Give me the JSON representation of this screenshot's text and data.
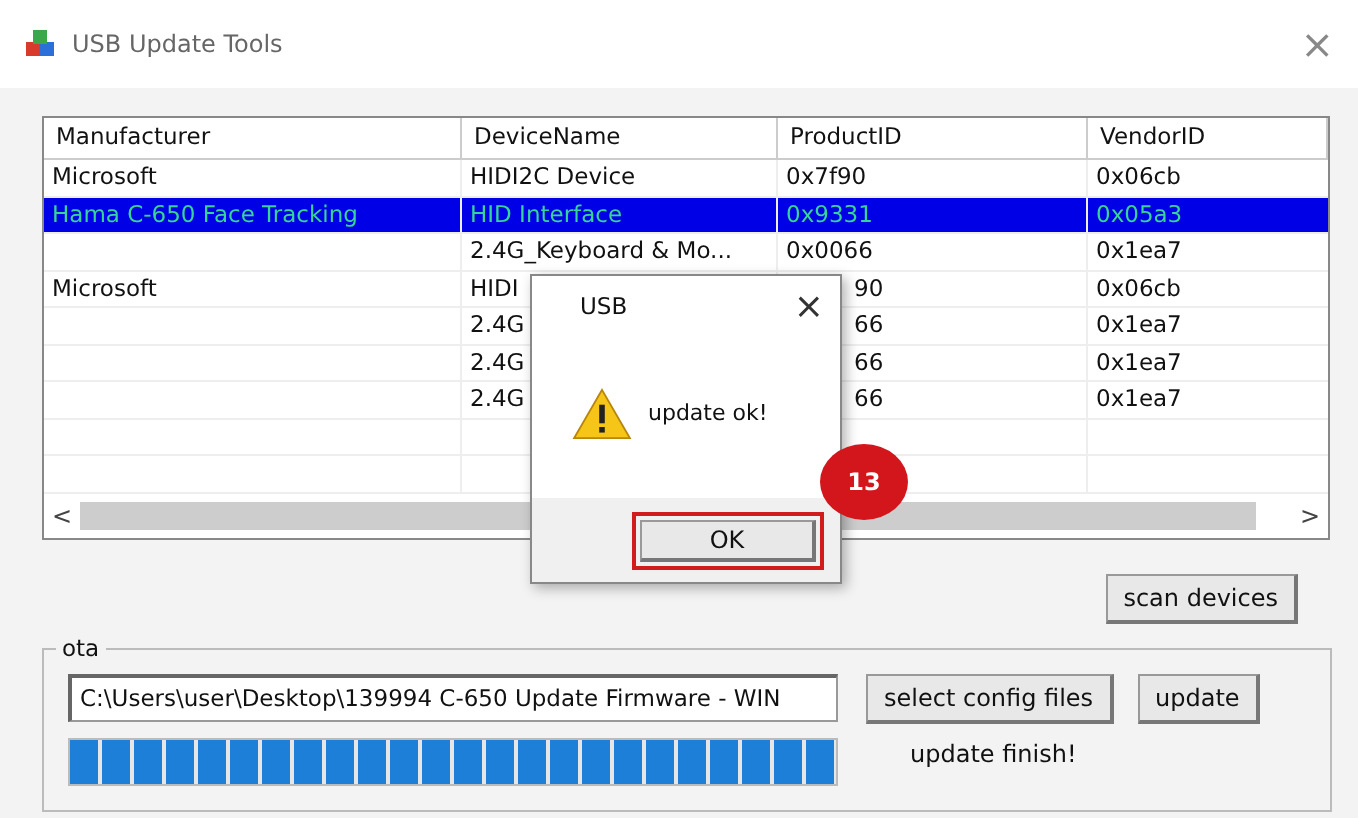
{
  "window": {
    "title": "USB Update Tools",
    "close": "×"
  },
  "table": {
    "columns": [
      "Manufacturer",
      "DeviceName",
      "ProductID",
      "VendorID"
    ],
    "rows": [
      {
        "manufacturer": "Microsoft",
        "device_name": "HIDI2C Device",
        "product_id": "0x7f90",
        "vendor_id": "0x06cb",
        "selected": false,
        "under_dialog": false
      },
      {
        "manufacturer": "Hama C-650 Face Tracking",
        "device_name": "HID Interface",
        "product_id": "0x9331",
        "vendor_id": "0x05a3",
        "selected": true,
        "under_dialog": false
      },
      {
        "device_name": "2.4G_Keyboard & Mo...",
        "product_id": "0x0066",
        "vendor_id": "0x1ea7",
        "selected": false,
        "under_dialog": false
      },
      {
        "manufacturer": "Microsoft",
        "device_name": "HIDI",
        "product_id": "90",
        "vendor_id": "0x06cb",
        "selected": false,
        "under_dialog": true
      },
      {
        "device_name": "2.4G",
        "product_id": "66",
        "vendor_id": "0x1ea7",
        "selected": false,
        "under_dialog": true
      },
      {
        "device_name": "2.4G",
        "product_id": "66",
        "vendor_id": "0x1ea7",
        "selected": false,
        "under_dialog": true
      },
      {
        "device_name": "2.4G",
        "product_id": "66",
        "vendor_id": "0x1ea7",
        "selected": false,
        "under_dialog": true
      }
    ],
    "scroll_left": "<",
    "scroll_right": ">"
  },
  "scan_button": "scan devices",
  "ota": {
    "label": "ota",
    "path": "C:\\Users\\user\\Desktop\\139994 C-650 Update Firmware - WIN",
    "progress": {
      "level": 1
    },
    "select_button": "select config files",
    "update_button": "update",
    "status": "update finish!"
  },
  "dialog": {
    "title": "USB",
    "close": "×",
    "message": "update ok!",
    "ok_button": "OK",
    "ok_highlighted": true,
    "step_badge": "13"
  }
}
